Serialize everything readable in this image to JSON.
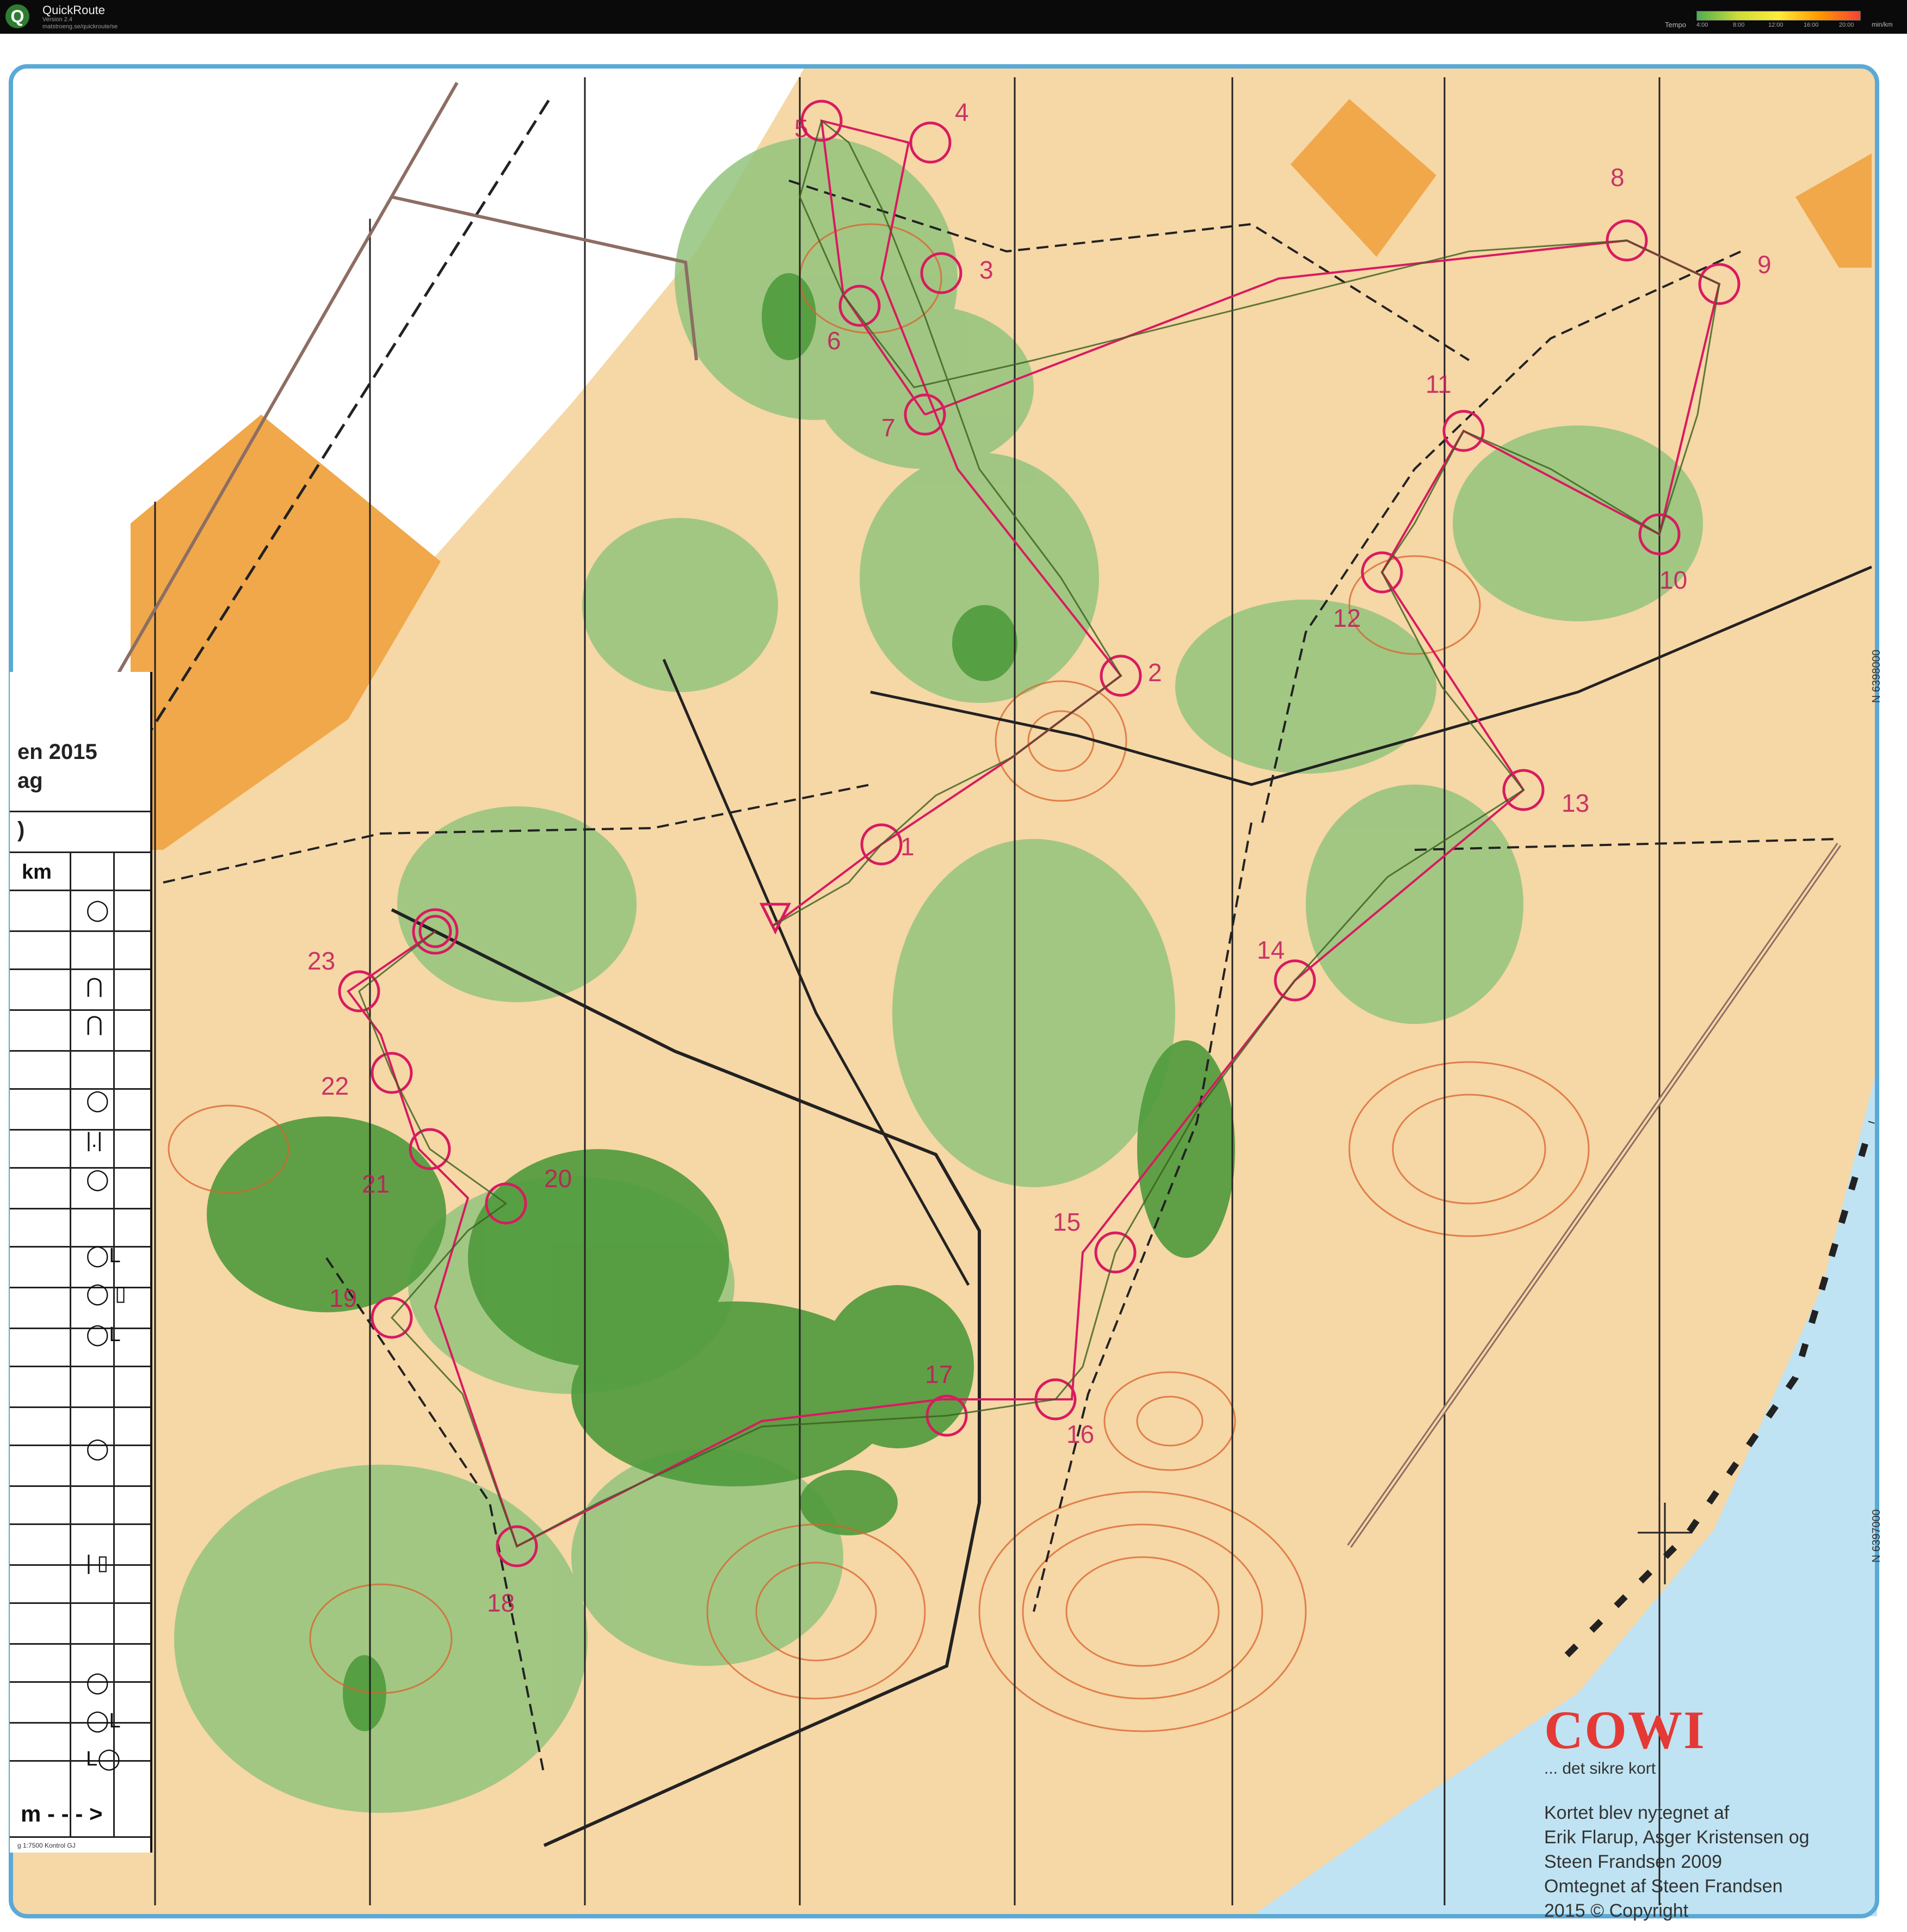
{
  "app": {
    "title": "QuickRoute",
    "version": "Version 2.4",
    "url": "matstroeng.se/quickroute/se",
    "tempo_label": "Tempo",
    "tempo_ticks": [
      "4:00",
      "8:00",
      "12:00",
      "16:00",
      "20:00"
    ],
    "tempo_unit": "min/km",
    "tempo_colors": [
      "#4caf50",
      "#cddc39",
      "#ffeb3b",
      "#ff9800",
      "#f44336"
    ]
  },
  "map": {
    "control_numbers": [
      "1",
      "2",
      "3",
      "4",
      "5",
      "6",
      "7",
      "8",
      "9",
      "10",
      "11",
      "12",
      "13",
      "14",
      "15",
      "16",
      "17",
      "18",
      "19",
      "20",
      "21",
      "22",
      "23"
    ],
    "grid_labels": [
      "N 6398000",
      "N 6397000"
    ],
    "colors": {
      "open_land": "#f6d7a6",
      "forest_green": "#7fb86a",
      "dark_green": "#4f9a3c",
      "contour": "#d9622b",
      "course": "#d81b60",
      "water": "#bfe3f2",
      "track": "#222222",
      "building": "#e8a64a"
    }
  },
  "description_sheet": {
    "title_line1": "en 2015",
    "title_line2": "ag",
    "title_line3": ")",
    "header": "km",
    "symbols": [
      "◯",
      "⋂",
      "⋂",
      "◯",
      "|.|",
      "◯",
      "◯L",
      "◯ ▯",
      "◯L",
      "◯",
      "| ▯",
      "◯",
      "◯L",
      "L◯"
    ],
    "footer": "m - - - >",
    "footer_note": "g 1:7500 Kontrol GJ"
  },
  "credits": {
    "logo": "COWI",
    "tagline": "... det sikre kort",
    "lines": [
      "Kortet blev nytegnet af",
      "Erik Flarup, Asger Kristensen og",
      "Steen Frandsen   2009",
      "Omtegnet af Steen Frandsen",
      "2015      © Copyright"
    ]
  }
}
